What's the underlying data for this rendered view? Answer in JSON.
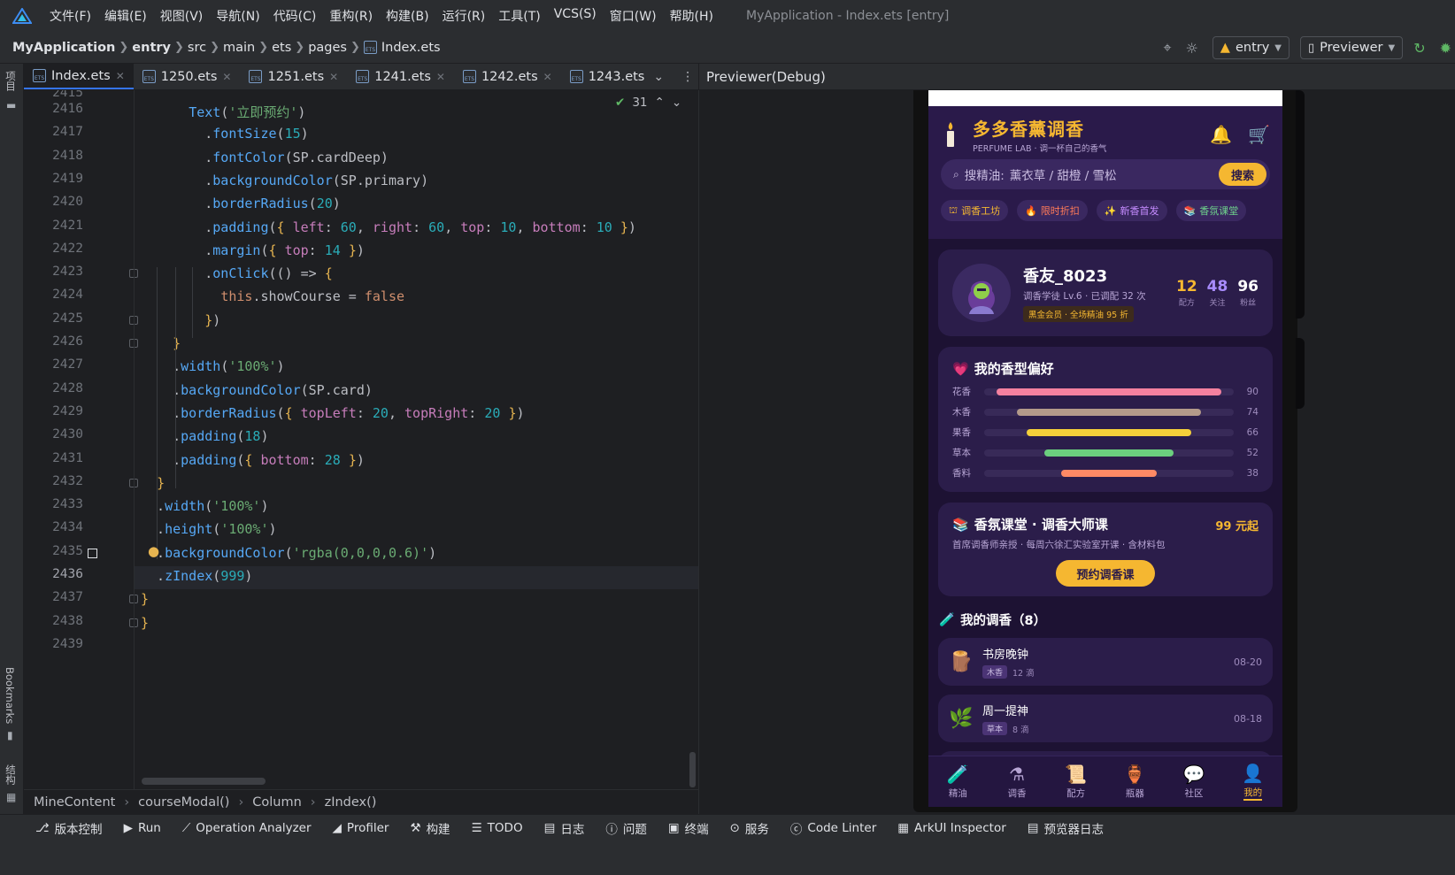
{
  "menu": [
    "文件(F)",
    "编辑(E)",
    "视图(V)",
    "导航(N)",
    "代码(C)",
    "重构(R)",
    "构建(B)",
    "运行(R)",
    "工具(T)",
    "VCS(S)",
    "窗口(W)",
    "帮助(H)"
  ],
  "window_title": "MyApplication - Index.ets [entry]",
  "breadcrumb": [
    "MyApplication",
    "entry",
    "src",
    "main",
    "ets",
    "pages",
    "Index.ets"
  ],
  "run_config": "entry",
  "device": "Previewer",
  "left_strip": {
    "project": "项目",
    "bookmarks": "Bookmarks",
    "structure": "结构"
  },
  "tabs": [
    {
      "label": "Index.ets",
      "active": true
    },
    {
      "label": "1250.ets"
    },
    {
      "label": "1251.ets"
    },
    {
      "label": "1241.ets"
    },
    {
      "label": "1242.ets"
    },
    {
      "label": "1243.ets"
    }
  ],
  "previewer_title": "Previewer(Debug)",
  "inspection_count": "31",
  "editor": {
    "first_partial_line": "2415",
    "current_line": "2436",
    "lines": [
      {
        "n": "2416",
        "code": "      Text('立即预约')"
      },
      {
        "n": "2417",
        "code": "        .fontSize(15)"
      },
      {
        "n": "2418",
        "code": "        .fontColor(SP.cardDeep)"
      },
      {
        "n": "2419",
        "code": "        .backgroundColor(SP.primary)"
      },
      {
        "n": "2420",
        "code": "        .borderRadius(20)"
      },
      {
        "n": "2421",
        "code": "        .padding({ left: 60, right: 60, top: 10, bottom: 10 })"
      },
      {
        "n": "2422",
        "code": "        .margin({ top: 14 })"
      },
      {
        "n": "2423",
        "code": "        .onClick(() => {"
      },
      {
        "n": "2424",
        "code": "          this.showCourse = false"
      },
      {
        "n": "2425",
        "code": "        })"
      },
      {
        "n": "2426",
        "code": "    }"
      },
      {
        "n": "2427",
        "code": "    .width('100%')"
      },
      {
        "n": "2428",
        "code": "    .backgroundColor(SP.card)"
      },
      {
        "n": "2429",
        "code": "    .borderRadius({ topLeft: 20, topRight: 20 })"
      },
      {
        "n": "2430",
        "code": "    .padding(18)"
      },
      {
        "n": "2431",
        "code": "    .padding({ bottom: 28 })"
      },
      {
        "n": "2432",
        "code": "  }"
      },
      {
        "n": "2433",
        "code": "  .width('100%')"
      },
      {
        "n": "2434",
        "code": "  .height('100%')"
      },
      {
        "n": "2435",
        "code": "  .backgroundColor('rgba(0,0,0,0.6)')"
      },
      {
        "n": "2436",
        "code": "  .zIndex(999)"
      },
      {
        "n": "2437",
        "code": "}"
      },
      {
        "n": "2438",
        "code": "}"
      },
      {
        "n": "2439",
        "code": ""
      }
    ]
  },
  "structure_path": [
    "MineContent",
    "courseModal()",
    "Column",
    "zIndex()"
  ],
  "tool_windows": [
    "版本控制",
    "Run",
    "Operation Analyzer",
    "Profiler",
    "构建",
    "TODO",
    "日志",
    "问题",
    "终端",
    "服务",
    "Code Linter",
    "ArkUI Inspector",
    "预览器日志"
  ],
  "phone": {
    "brand_title": "多多香薰调香",
    "brand_sub": "PERFUME LAB · 调一杯自己的香气",
    "search_prefix": "搜精油:",
    "search_placeholder": "薰衣草 / 甜橙 / 雪松",
    "search_button": "搜索",
    "chips": [
      {
        "icon": "⛫",
        "label": "调香工坊",
        "color": "#f5b731"
      },
      {
        "icon": "🔥",
        "label": "限时折扣",
        "color": "#ff7a59"
      },
      {
        "icon": "✨",
        "label": "新香首发",
        "color": "#c58cff"
      },
      {
        "icon": "📚",
        "label": "香氛课堂",
        "color": "#6fd48c"
      }
    ],
    "profile": {
      "name": "香友_8023",
      "info": "调香学徒 Lv.6 · 已调配 32 次",
      "vip": "黑金会员 · 全场精油 95 折",
      "stats": [
        {
          "value": "12",
          "label": "配方",
          "color": "#f5b731"
        },
        {
          "value": "48",
          "label": "关注",
          "color": "#a98cff"
        },
        {
          "value": "96",
          "label": "粉丝",
          "color": "#ffffff"
        }
      ]
    },
    "preference": {
      "title": "我的香型偏好",
      "bars": [
        {
          "label": "花香",
          "value": 90,
          "color": "#f4819f"
        },
        {
          "label": "木香",
          "value": 74,
          "color": "#b39a8a"
        },
        {
          "label": "果香",
          "value": 66,
          "color": "#f5d03a"
        },
        {
          "label": "草本",
          "value": 52,
          "color": "#6bcf7e"
        },
        {
          "label": "香料",
          "value": 38,
          "color": "#ff8a65"
        }
      ]
    },
    "course": {
      "title": "香氛课堂 · 调香大师课",
      "price": "99 元起",
      "desc": "首席调香师亲授 · 每周六徐汇实验室开课 · 含材料包",
      "button": "预约调香课"
    },
    "my_section_title": "我的调香（8）",
    "items": [
      {
        "emoji": "🪵",
        "name": "书房晚钟",
        "tag": "木香",
        "drops": "12 滴",
        "date": "08-20"
      },
      {
        "emoji": "🌿",
        "name": "周一提神",
        "tag": "草本",
        "drops": "8 滴",
        "date": "08-18"
      }
    ],
    "tabbar": [
      {
        "icon": "🧪",
        "label": "精油"
      },
      {
        "icon": "⚗",
        "label": "调香"
      },
      {
        "icon": "📜",
        "label": "配方"
      },
      {
        "icon": "🏺",
        "label": "瓶器"
      },
      {
        "icon": "💬",
        "label": "社区"
      },
      {
        "icon": "👤",
        "label": "我的",
        "active": true
      }
    ]
  }
}
